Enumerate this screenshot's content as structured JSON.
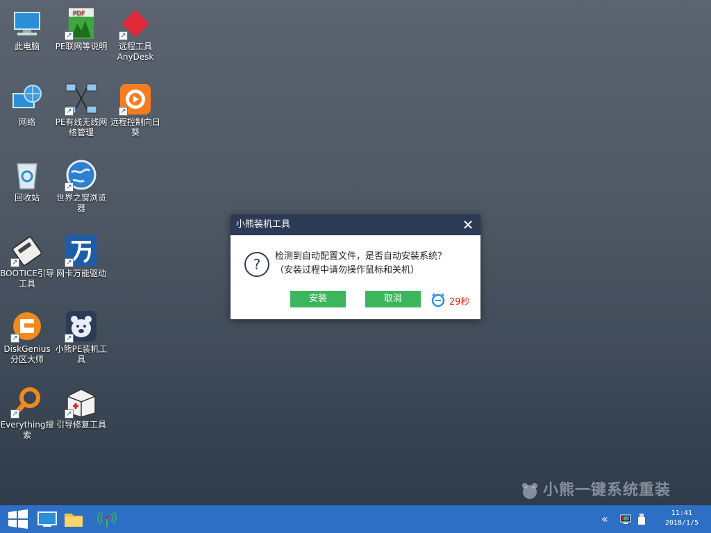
{
  "desktop_icons": [
    {
      "label": "此电脑",
      "icon": "computer-icon"
    },
    {
      "label": "PE联网等说明",
      "icon": "pdf-icon"
    },
    {
      "label": "远程工具AnyDesk",
      "icon": "anydesk-icon"
    },
    {
      "label": "网络",
      "icon": "network-icon"
    },
    {
      "label": "PE有线无线网络管理",
      "icon": "network-manager-icon"
    },
    {
      "label": "远程控制向日葵",
      "icon": "sunflower-icon"
    },
    {
      "label": "回收站",
      "icon": "recycle-bin-icon"
    },
    {
      "label": "世界之窗浏览器",
      "icon": "globe-browser-icon"
    },
    {
      "label": "BOOTICE引导工具",
      "icon": "bootice-icon"
    },
    {
      "label": "网卡万能驱动",
      "icon": "wan-driver-icon"
    },
    {
      "label": "DiskGenius分区大师",
      "icon": "diskgenius-icon"
    },
    {
      "label": "小熊PE装机工具",
      "icon": "bear-pe-icon"
    },
    {
      "label": "Everything搜索",
      "icon": "magnifier-icon"
    },
    {
      "label": "引导修复工具",
      "icon": "repair-kit-icon"
    }
  ],
  "watermark": {
    "text": "小熊一键系统重装"
  },
  "dialog": {
    "title": "小熊装机工具",
    "message_line1": "检测到自动配置文件，是否自动安装系统？",
    "message_line2": "（安装过程中请勿操作鼠标和关机）",
    "install_label": "安装",
    "cancel_label": "取消",
    "countdown": "29秒",
    "close_glyph": "✕",
    "question_glyph": "?"
  },
  "taskbar": {
    "time": "11:41",
    "date": "2018/1/5",
    "chevron_glyph": "«"
  },
  "colors": {
    "dialog_title_bg": "#2c3b55",
    "button_green": "#3cb65c",
    "countdown_red": "#e02020",
    "taskbar_blue": "#2d6fc4"
  }
}
